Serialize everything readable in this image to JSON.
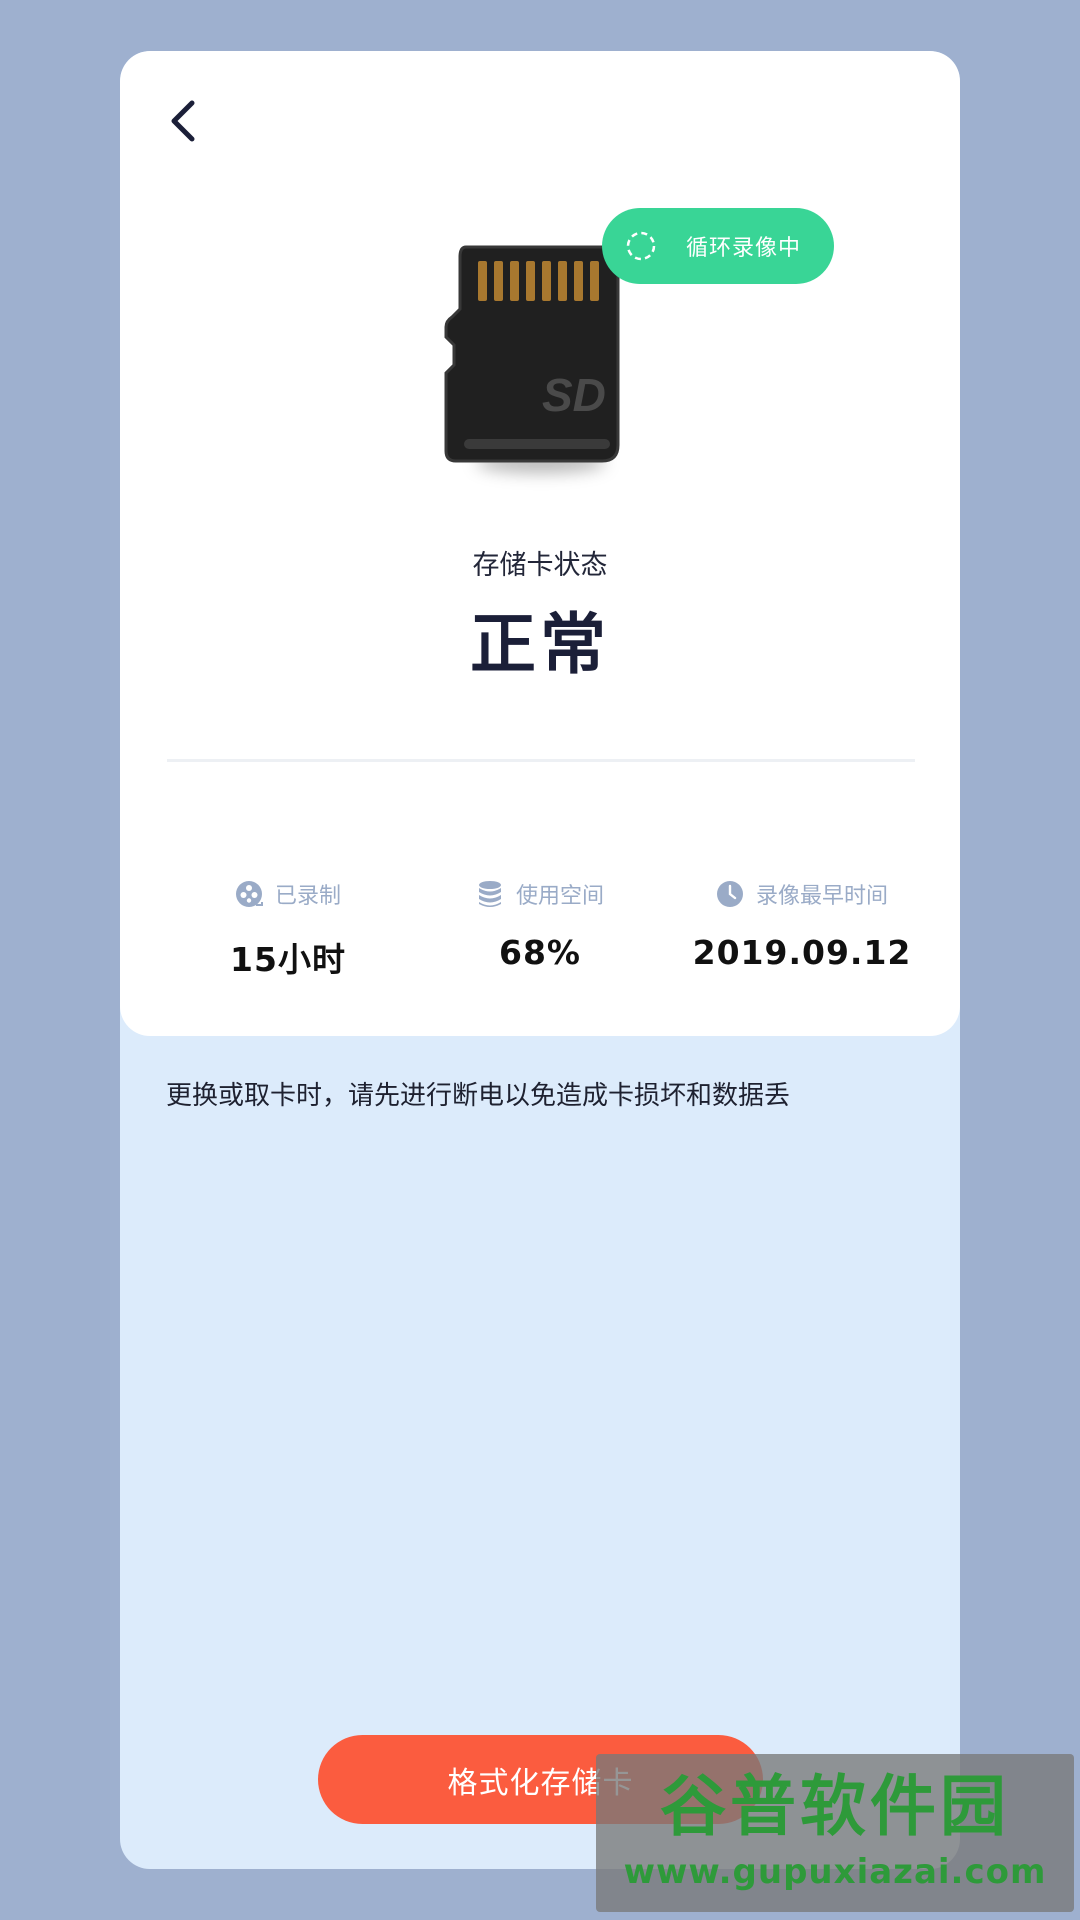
{
  "header": {
    "back_icon": "chevron-left-icon"
  },
  "status_badge": {
    "icon": "loading-ring-icon",
    "label": "循环录像中"
  },
  "card": {
    "sd_card_icon": "sd-card-icon",
    "sd_card_mark": "SD",
    "state_label": "存储卡状态",
    "state_value": "正常"
  },
  "stats": [
    {
      "icon": "film-reel-icon",
      "label": "已录制",
      "value": "15小时"
    },
    {
      "icon": "database-icon",
      "label": "使用空间",
      "value": "68%"
    },
    {
      "icon": "clock-icon",
      "label": "录像最早时间",
      "value": "2019.09.12"
    }
  ],
  "notice": "更换或取卡时，请先进行断电以免造成卡损坏和数据丢",
  "format_button": {
    "label": "格式化存储卡"
  },
  "watermark": {
    "title": "谷普软件园",
    "url": "www.gupuxiazai.com"
  },
  "colors": {
    "page_bg": "#9eb0cf",
    "panel_bg": "#dcebfb",
    "accent_green": "#39d596",
    "accent_red": "#fb5c3f",
    "muted_blue": "#9aabc7"
  }
}
